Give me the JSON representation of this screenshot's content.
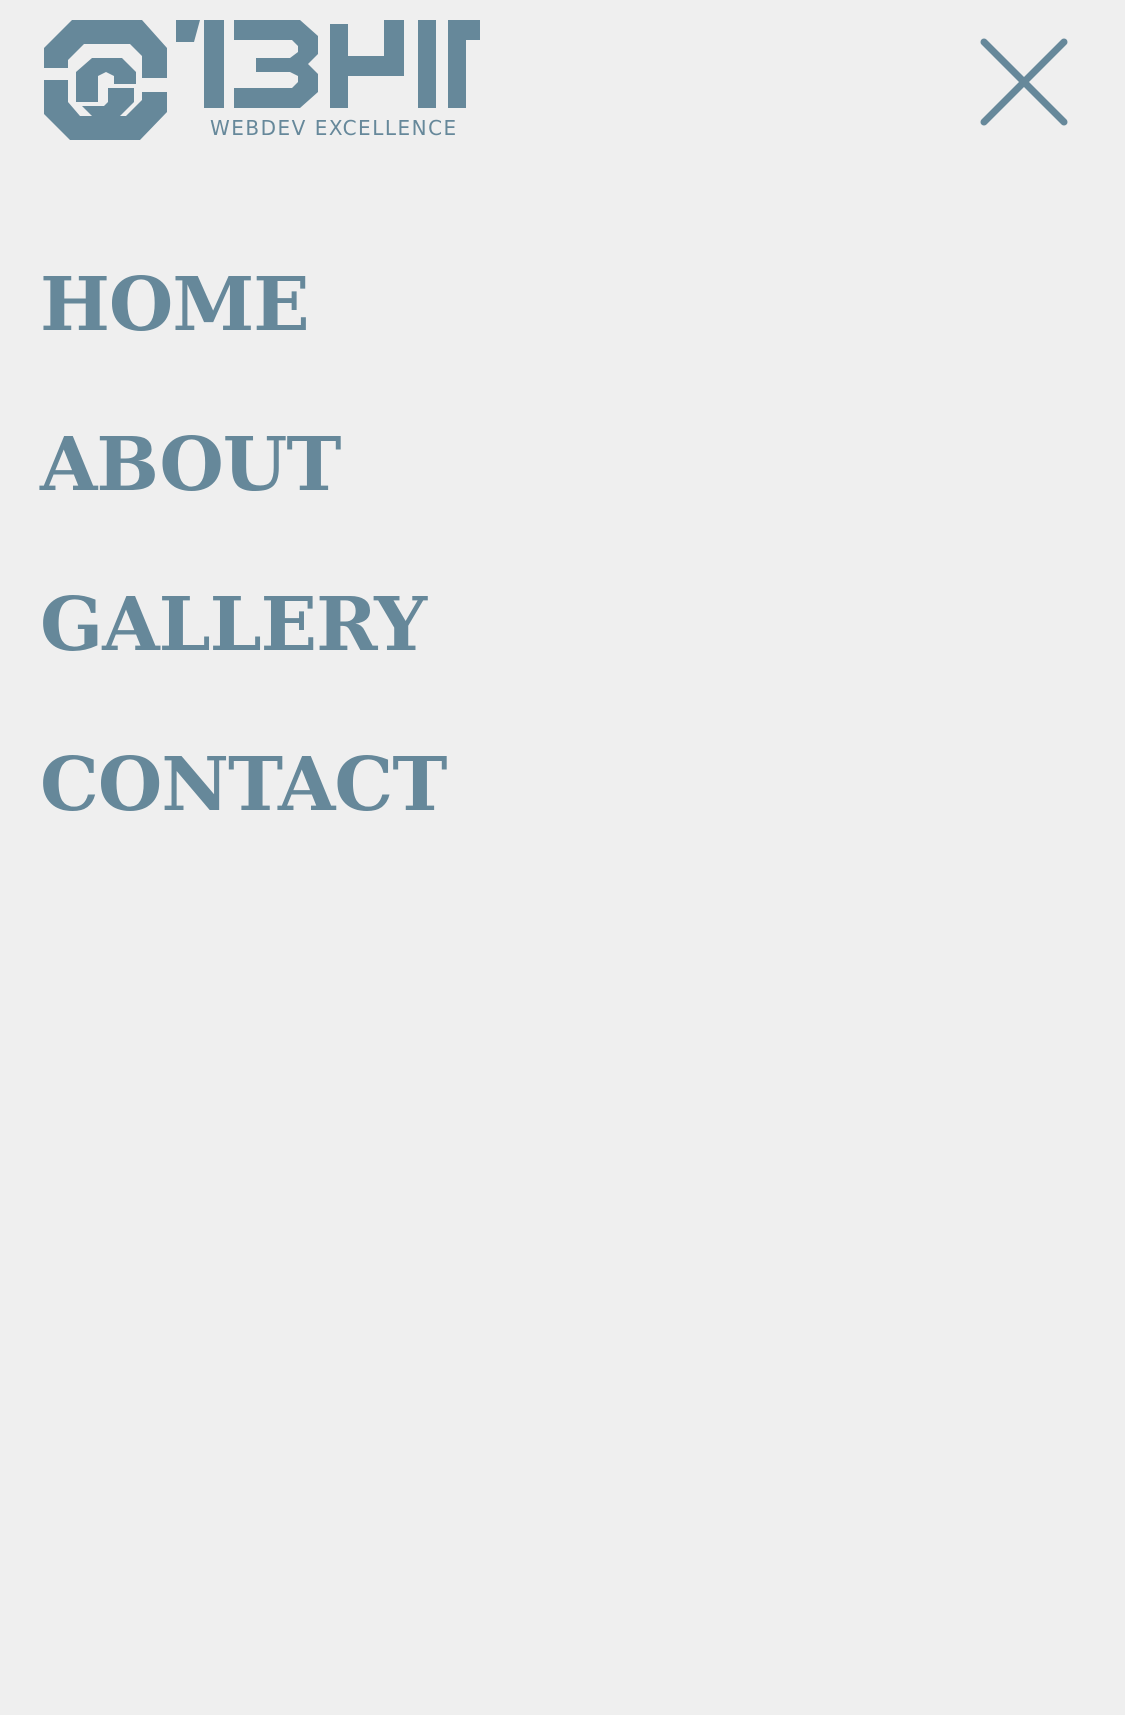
{
  "brand": {
    "logo_mark": "13HIT",
    "tagline": "WEBDEV EXCELLENCE",
    "logo_icon": "hexagon-swirl-logo-icon",
    "color": "#66889a"
  },
  "header": {
    "close_icon": "close-icon",
    "close_color": "#66889a"
  },
  "menu": {
    "color": "#66889a",
    "items": [
      {
        "label": "HOME"
      },
      {
        "label": "ABOUT"
      },
      {
        "label": "GALLERY"
      },
      {
        "label": "CONTACT"
      }
    ]
  },
  "colors": {
    "background": "#efefef",
    "accent": "#66889a"
  }
}
